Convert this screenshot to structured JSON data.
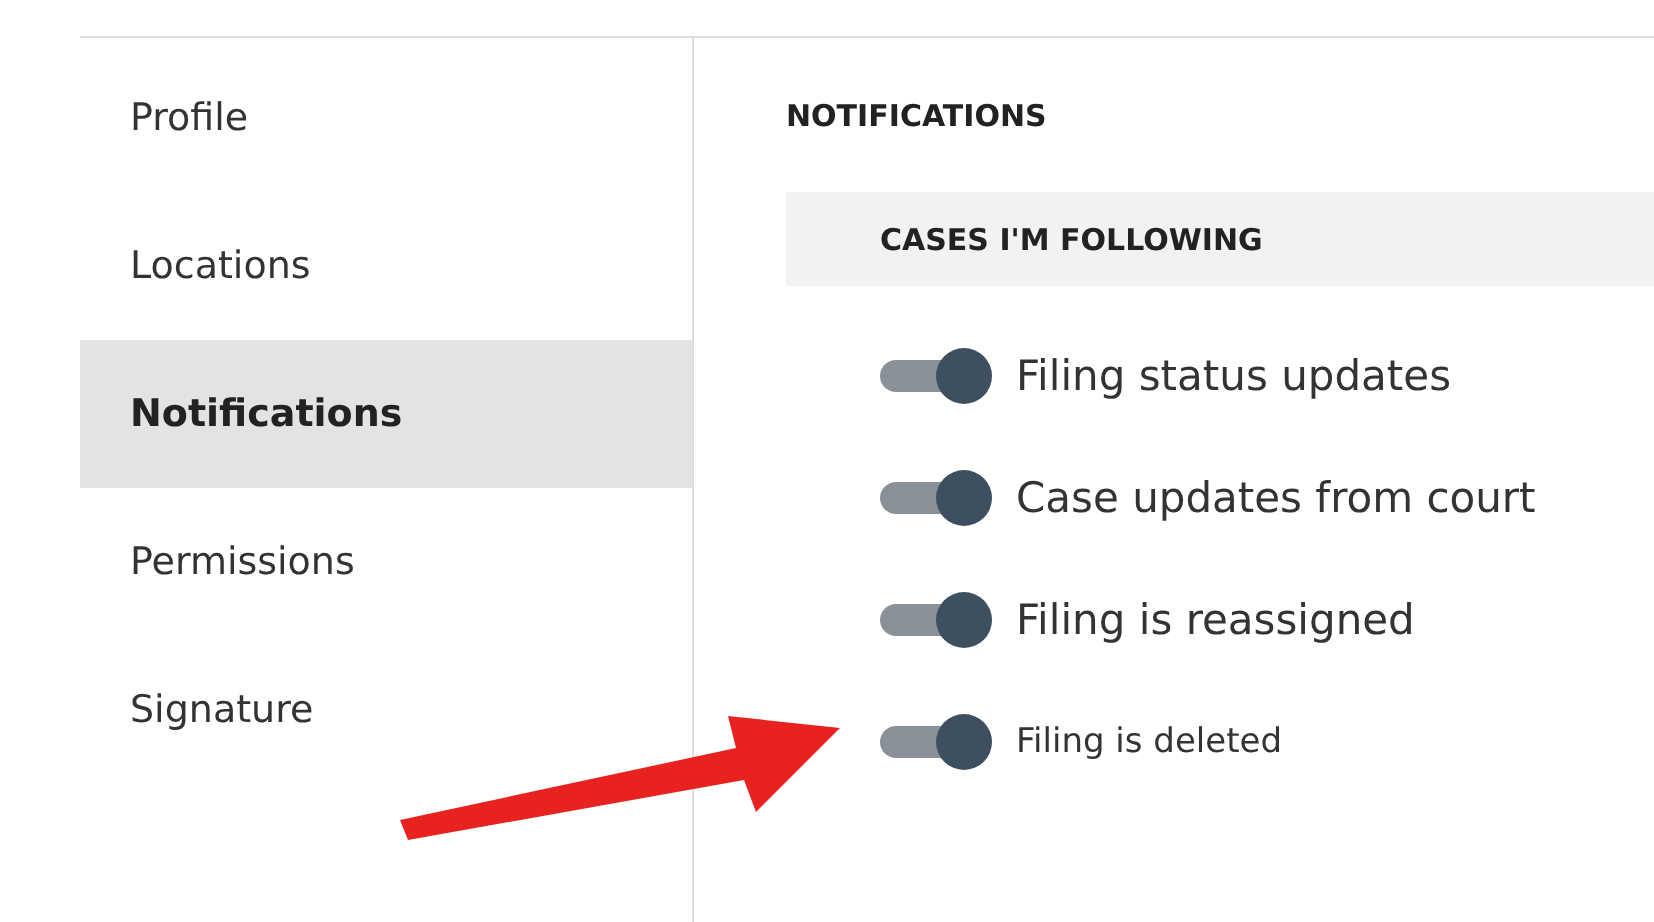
{
  "sidebar": {
    "items": [
      {
        "label": "Profile",
        "selected": false
      },
      {
        "label": "Locations",
        "selected": false
      },
      {
        "label": "Notifications",
        "selected": true
      },
      {
        "label": "Permissions",
        "selected": false
      },
      {
        "label": "Signature",
        "selected": false
      }
    ]
  },
  "content": {
    "title": "NOTIFICATIONS",
    "section": "CASES I'M FOLLOWING",
    "toggles": [
      {
        "label": "Filing status updates",
        "on": true,
        "kind": "normal"
      },
      {
        "label": "Case updates from court",
        "on": true,
        "kind": "normal"
      },
      {
        "label": "Filing is reassigned",
        "on": true,
        "kind": "normal"
      },
      {
        "label": "Filing is deleted",
        "on": true,
        "kind": "small"
      }
    ]
  }
}
